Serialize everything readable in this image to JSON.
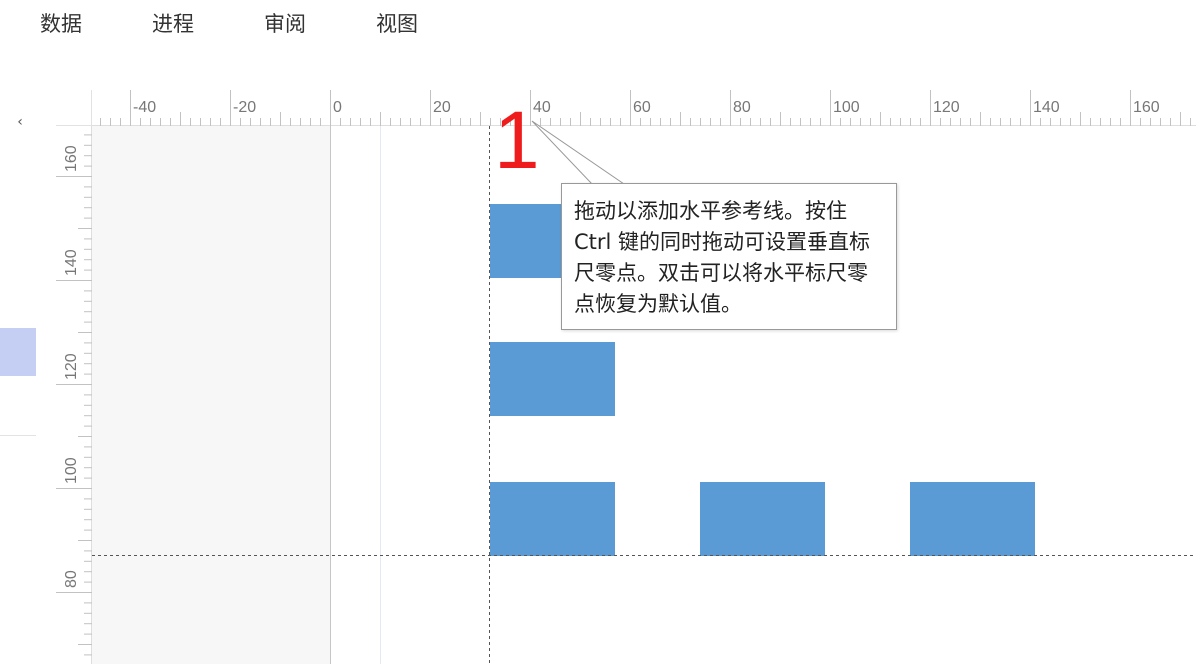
{
  "menu": {
    "items": [
      {
        "id": "data",
        "label": "数据"
      },
      {
        "id": "process",
        "label": "进程"
      },
      {
        "id": "review",
        "label": "审阅"
      },
      {
        "id": "view",
        "label": "视图"
      }
    ]
  },
  "left_panel": {
    "collapse_glyph": "‹"
  },
  "rulers": {
    "horizontal": {
      "labels": [
        "-40",
        "-20",
        "0",
        "20",
        "40",
        "60",
        "80",
        "100",
        "120",
        "140",
        "160"
      ]
    },
    "vertical": {
      "labels": [
        "160",
        "140",
        "120",
        "100",
        "80"
      ]
    }
  },
  "canvas": {
    "shape_count": 5,
    "shape_color": "#5b9bd5",
    "guide_style": "dashed"
  },
  "annotation": {
    "number": "1",
    "color": "#ee1c1c"
  },
  "tooltip": {
    "text": "拖动以添加水平参考线。按住 Ctrl 键的同时拖动可设置垂直标尺零点。双击可以将水平标尺零点恢复为默认值。"
  },
  "colors": {
    "accent": "#5b9bd5",
    "panel_highlight": "#c5cff3",
    "ruler_text": "#777777"
  }
}
